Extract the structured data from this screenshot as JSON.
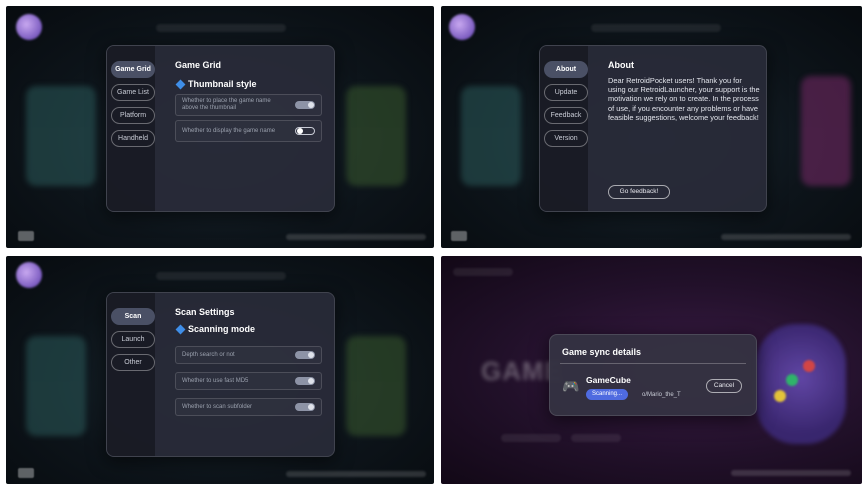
{
  "q1": {
    "tabs": [
      "Game Grid",
      "Game List",
      "Platform",
      "Handheld"
    ],
    "title": "Game Grid",
    "section": "Thumbnail style",
    "rows": [
      {
        "label": "Whether to place the game name above the thumbnail",
        "toggle": "on"
      },
      {
        "label": "Whether to display the game name",
        "toggle": "off"
      }
    ]
  },
  "q2": {
    "tabs": [
      "About",
      "Update",
      "Feedback",
      "Version"
    ],
    "title": "About",
    "text": "Dear RetroidPocket users! Thank you for using our RetroidLauncher, your support is the motivation we rely on to create. In the process of use, if you encounter any problems or have feasible suggestions, welcome your feedback!",
    "feedback_button": "Go feedback!"
  },
  "q3": {
    "tabs": [
      "Scan",
      "Launch",
      "Other"
    ],
    "title": "Scan Settings",
    "section": "Scanning mode",
    "rows": [
      {
        "label": "Depth search or not",
        "toggle": "on"
      },
      {
        "label": "Whether to use fast MD5",
        "toggle": "on"
      },
      {
        "label": "Whether to scan subfolder",
        "toggle": "on"
      }
    ]
  },
  "q4": {
    "background_text": "GAME",
    "title": "Game sync details",
    "game": "GameCube",
    "status": "Scanning...",
    "path": "o/Mario_the_T",
    "cancel": "Cancel"
  },
  "colors": {
    "accent": "#3f8ee8",
    "scan_badge": "#4f6be0",
    "dialog_bg": "#282b38",
    "sidebar_bg": "#181a24"
  }
}
